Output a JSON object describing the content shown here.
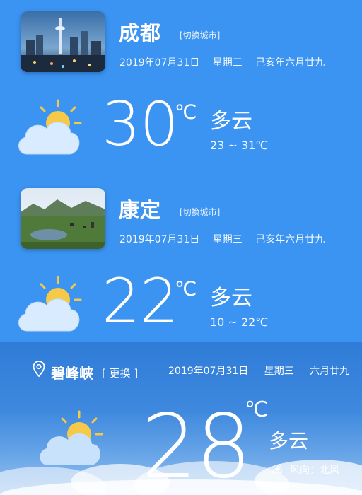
{
  "cities": [
    {
      "name": "成都",
      "switch_label": "[切换城市]",
      "date": "2019年07月31日",
      "weekday": "星期三",
      "lunar": "己亥年六月廿九",
      "temperature": "30",
      "unit": "℃",
      "condition": "多云",
      "range": "23 ~ 31℃",
      "icon": "partly-cloudy-icon"
    },
    {
      "name": "康定",
      "switch_label": "[切换城市]",
      "date": "2019年07月31日",
      "weekday": "星期三",
      "lunar": "己亥年六月廿九",
      "temperature": "22",
      "unit": "℃",
      "condition": "多云",
      "range": "10 ~ 22℃",
      "icon": "partly-cloudy-icon"
    }
  ],
  "panel": {
    "city": "碧峰峡",
    "change_label": "[ 更换 ]",
    "date": "2019年07月31日",
    "weekday": "星期三",
    "lunar": "六月廿九",
    "temperature": "28",
    "unit": "℃",
    "condition": "多云",
    "wind": "风向：北风",
    "icon": "partly-cloudy-icon"
  },
  "colors": {
    "background": "#3b93f2",
    "sun": "#f7c948",
    "cloud": "#d9ecff"
  }
}
